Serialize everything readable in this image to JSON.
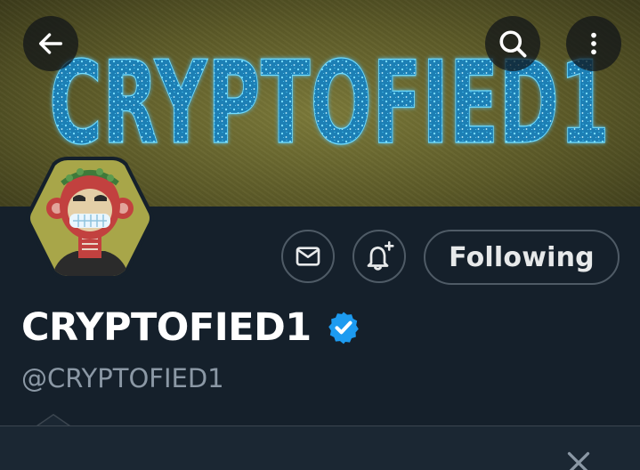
{
  "banner": {
    "text": "CRYPTOFIED1",
    "back_icon": "arrow-left-icon",
    "search_icon": "search-icon",
    "more_icon": "more-vertical-icon"
  },
  "profile": {
    "display_name": "CRYPTOFIED1",
    "handle": "@CRYPTOFIED1",
    "verified": true
  },
  "actions": {
    "message_icon": "envelope-icon",
    "notify_icon": "bell-plus-icon",
    "following_label": "Following"
  },
  "popup": {
    "close_icon": "close-icon"
  },
  "colors": {
    "background": "#15202b",
    "verified_blue": "#1d9bf0",
    "banner_text": "#3cb6e8"
  }
}
